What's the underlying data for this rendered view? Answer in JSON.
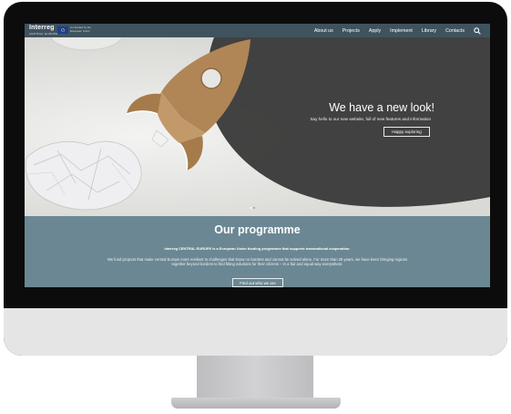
{
  "header": {
    "logo": "Interreg",
    "logo_sub": "CENTRAL EUROPE",
    "eu_text": "Co-funded by the European Union",
    "nav": [
      "About us",
      "Projects",
      "Apply",
      "Implement",
      "Library",
      "Contacts"
    ]
  },
  "hero": {
    "title": "We have a new look!",
    "subtitle": "Say hello to our new website, full of new features and information",
    "button": "Happy exploring"
  },
  "programme": {
    "title": "Our programme",
    "lead": "Interreg CENTRAL EUROPE is a European Union funding programme that supports transnational cooperation.",
    "body": "We fund projects that make central Europe more resilient to challenges that know no borders and cannot be solved alone. For more than 25 years, we have been bringing regions together beyond borders to find fitting solutions for their citizens – in a fair and equal way everywhere.",
    "button": "Find out who we are"
  },
  "colors": {
    "topbar": "#3f535e",
    "programme_bg": "#6b8793",
    "hero_shape": "#3a3a3a",
    "rocket": "#b08656"
  },
  "icons": [
    "search-icon",
    "eu-flag-icon"
  ]
}
